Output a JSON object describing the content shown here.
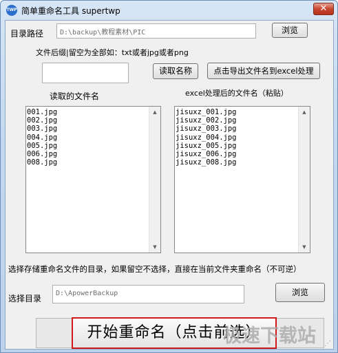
{
  "window": {
    "title": "简单重命名工具 supertwp",
    "icon_text": "TWP",
    "close_label": "✕"
  },
  "source": {
    "label": "目录路径",
    "path": "D:\\backup\\教程素材\\PIC",
    "browse_label": "浏览"
  },
  "suffix": {
    "label": "文件后缀|留空为全部如：txt或者jpg或者png",
    "value": ""
  },
  "actions": {
    "read_names_label": "读取名称",
    "export_excel_label": "点击导出文件名到excel处理"
  },
  "left_list": {
    "header": "读取的文件名",
    "items": [
      "001.jpg",
      "002.jpg",
      "003.jpg",
      "004.jpg",
      "005.jpg",
      "006.jpg",
      "008.jpg"
    ]
  },
  "right_list": {
    "header": "excel处理后的文件名（粘贴）",
    "items": [
      "jisuxz_001.jpg",
      "jisuxz_002.jpg",
      "jisuxz_003.jpg",
      "jisuxz_004.jpg",
      "jisuxz_005.jpg",
      "jisuxz_006.jpg",
      "jisuxz_008.jpg"
    ]
  },
  "target": {
    "note": "选择存储重命名文件的目录，如果留空不选择，直接在当前文件夹重命名（不可逆）",
    "label": "选择目录",
    "path": "D:\\ApowerBackup",
    "browse_label": "浏览"
  },
  "start_button": {
    "label": "开始重命名（点击前选）"
  },
  "watermark": {
    "text": "极速下载站"
  },
  "colors": {
    "accent_border": "#d01818",
    "titlebar": "#c3d8ef"
  }
}
